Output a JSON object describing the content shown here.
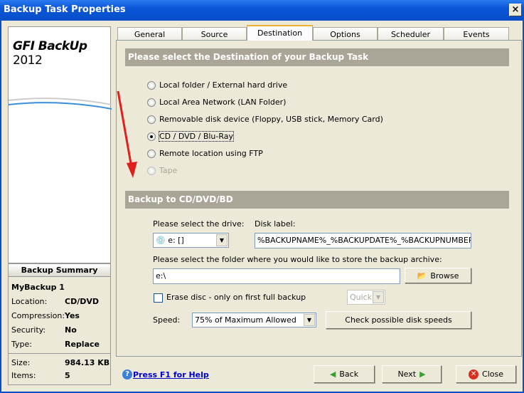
{
  "window": {
    "title": "Backup Task Properties",
    "close": "×"
  },
  "logo": {
    "brand": "GFI BackUp",
    "year": "2012"
  },
  "summary": {
    "title": "Backup Summary",
    "name": "MyBackup 1",
    "rows": [
      {
        "label": "Location:",
        "value": "CD/DVD"
      },
      {
        "label": "Compression:",
        "value": "Yes"
      },
      {
        "label": "Security:",
        "value": "No"
      },
      {
        "label": "Type:",
        "value": "Replace"
      }
    ],
    "size_label": "Size:",
    "size": "984.13 KB",
    "items_label": "Items:",
    "items": "5"
  },
  "tabs": [
    "General",
    "Source",
    "Destination",
    "Options",
    "Scheduler",
    "Events"
  ],
  "active_tab": "Destination",
  "dest_header": "Please select the Destination of your Backup Task",
  "options": [
    {
      "label": "Local folder / External hard drive",
      "selected": false,
      "enabled": true
    },
    {
      "label": "Local Area Network (LAN Folder)",
      "selected": false,
      "enabled": true
    },
    {
      "label": "Removable disk device (Floppy, USB stick, Memory Card)",
      "selected": false,
      "enabled": true
    },
    {
      "label": "CD / DVD / Blu-Ray",
      "selected": true,
      "enabled": true
    },
    {
      "label": "Remote location using FTP",
      "selected": false,
      "enabled": true
    },
    {
      "label": "Tape",
      "selected": false,
      "enabled": false
    }
  ],
  "cd_header": "Backup to CD/DVD/BD",
  "drive_label": "Please select the drive:",
  "drive_value": "e: []",
  "disk_label_label": "Disk label:",
  "disk_label_value": "%BACKUPNAME%_%BACKUPDATE%_%BACKUPNUMBER%",
  "folder_label": "Please select the folder where you would like to store the backup archive:",
  "folder_value": "e:\\",
  "browse": "Browse",
  "erase_label": "Erase disc - only on first full backup",
  "erase_checked": false,
  "erase_mode": "Quick",
  "speed_label": "Speed:",
  "speed_value": "75% of Maximum Allowed",
  "check_speeds": "Check possible disk speeds",
  "help": "Press F1 for Help",
  "buttons": {
    "back": "Back",
    "next": "Next",
    "close": "Close"
  }
}
